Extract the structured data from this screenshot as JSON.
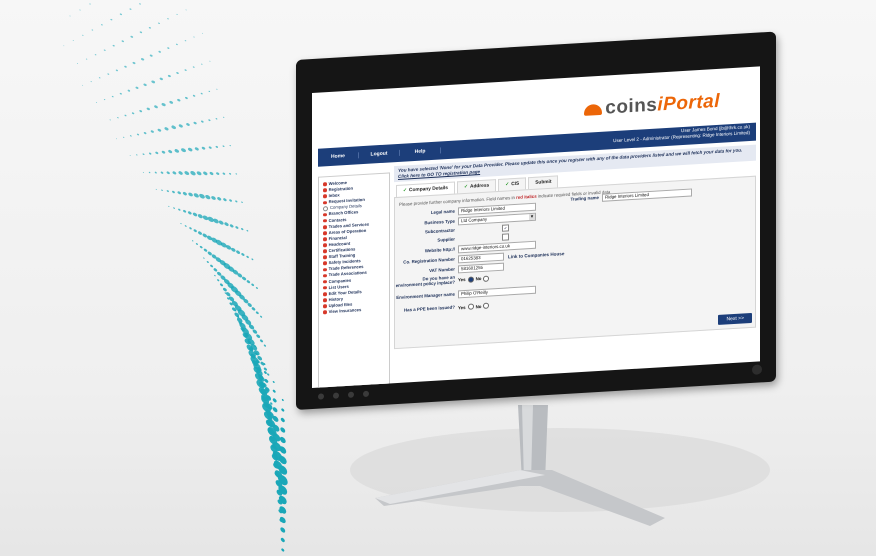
{
  "brand": {
    "logo_prefix": "coins",
    "logo_suffix": "iPortal"
  },
  "topnav": {
    "items": [
      "Home",
      "Logout",
      "Help"
    ],
    "user_line1": "User James Bond (jb@thrk.co.uk)",
    "user_line2": "User Level 2 - Administrator  (Representing: Ridge Interiors Limited)"
  },
  "sidebar": {
    "items": [
      {
        "label": "Welcome",
        "complete": false
      },
      {
        "label": "Registration",
        "complete": false
      },
      {
        "label": "Inbox",
        "complete": false
      },
      {
        "label": "Request Invitation",
        "complete": false
      },
      {
        "label": "Company Details",
        "complete": true
      },
      {
        "label": "Branch Offices",
        "complete": false
      },
      {
        "label": "Contacts",
        "complete": false
      },
      {
        "label": "Trades and Services",
        "complete": false
      },
      {
        "label": "Areas of Operation",
        "complete": false
      },
      {
        "label": "Financial",
        "complete": false
      },
      {
        "label": "Headcount",
        "complete": false
      },
      {
        "label": "Certifications",
        "complete": false
      },
      {
        "label": "Staff Training",
        "complete": false
      },
      {
        "label": "Safety Incidents",
        "complete": false
      },
      {
        "label": "Trade References",
        "complete": false
      },
      {
        "label": "Trade Associations",
        "complete": false
      },
      {
        "label": "Companies",
        "complete": false
      },
      {
        "label": "List Users",
        "complete": false
      },
      {
        "label": "Edit Your Details",
        "complete": false
      },
      {
        "label": "History",
        "complete": false
      },
      {
        "label": "Upload files",
        "complete": false
      },
      {
        "label": "View Insurances",
        "complete": false
      }
    ]
  },
  "notice": {
    "text": "You have selected 'None' for your Data Provider. Please update this once you register with any of the data providers listed and we will fetch your data for you.",
    "link": "Click here to GO TO registration page"
  },
  "tabs": [
    {
      "label": "Company Details",
      "done": true,
      "active": true
    },
    {
      "label": "Address",
      "done": true,
      "active": false
    },
    {
      "label": "CIS",
      "done": true,
      "active": false
    },
    {
      "label": "Submit",
      "done": false,
      "active": false
    }
  ],
  "form": {
    "intro_before": "Please provide further company information. Field names in",
    "intro_red": "red italics",
    "intro_after": "indicate required fields or invalid data",
    "legal_name_label": "Legal name",
    "legal_name_value": "Ridge Interiors Limited",
    "trading_name_label": "Trading name",
    "trading_name_value": "Ridge Interiors Limited",
    "business_type_label": "Business Type",
    "business_type_value": "Ltd Company",
    "subcontractor_label": "Subcontractor",
    "supplier_label": "Supplier",
    "website_label": "Website http://",
    "website_value": "www.ridge-interiors.co.uk",
    "reg_number_label": "Co. Registration Number",
    "reg_number_value": "01625383",
    "companies_house_link": "Link to Companies House",
    "vat_label": "VAT Number",
    "vat_value": "581601255",
    "env_policy_label": "Do you have an environment policy inplace?",
    "env_manager_label": "Environment Manager name",
    "env_manager_value": "Philip O'Reilly",
    "ppe_label": "Has a PPE been issued?",
    "yes": "Yes",
    "no": "No"
  },
  "next_button": "Next >>"
}
